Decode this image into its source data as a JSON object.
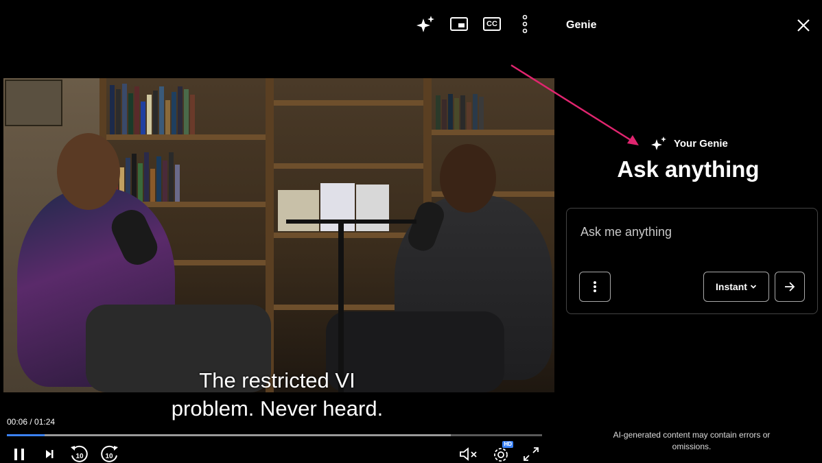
{
  "player": {
    "timecode": "00:06 / 01:24",
    "progress_fraction": 0.071,
    "buffered_fraction": 0.83,
    "subtitle_line1": "The restricted VI",
    "subtitle_line2": "problem. Never heard.",
    "quality_badge": "HD",
    "cc_label": "CC",
    "skip_back_label": "10",
    "skip_forward_label": "10",
    "accent_color": "#3b82f6"
  },
  "panel": {
    "title": "Genie",
    "brand": "Your Genie",
    "heading": "Ask anything",
    "input_placeholder": "Ask me anything",
    "input_value": "",
    "mode_label": "Instant",
    "disclaimer": "AI-generated content may contain errors or omissions."
  },
  "annotation": {
    "arrow_color": "#e0256f"
  }
}
